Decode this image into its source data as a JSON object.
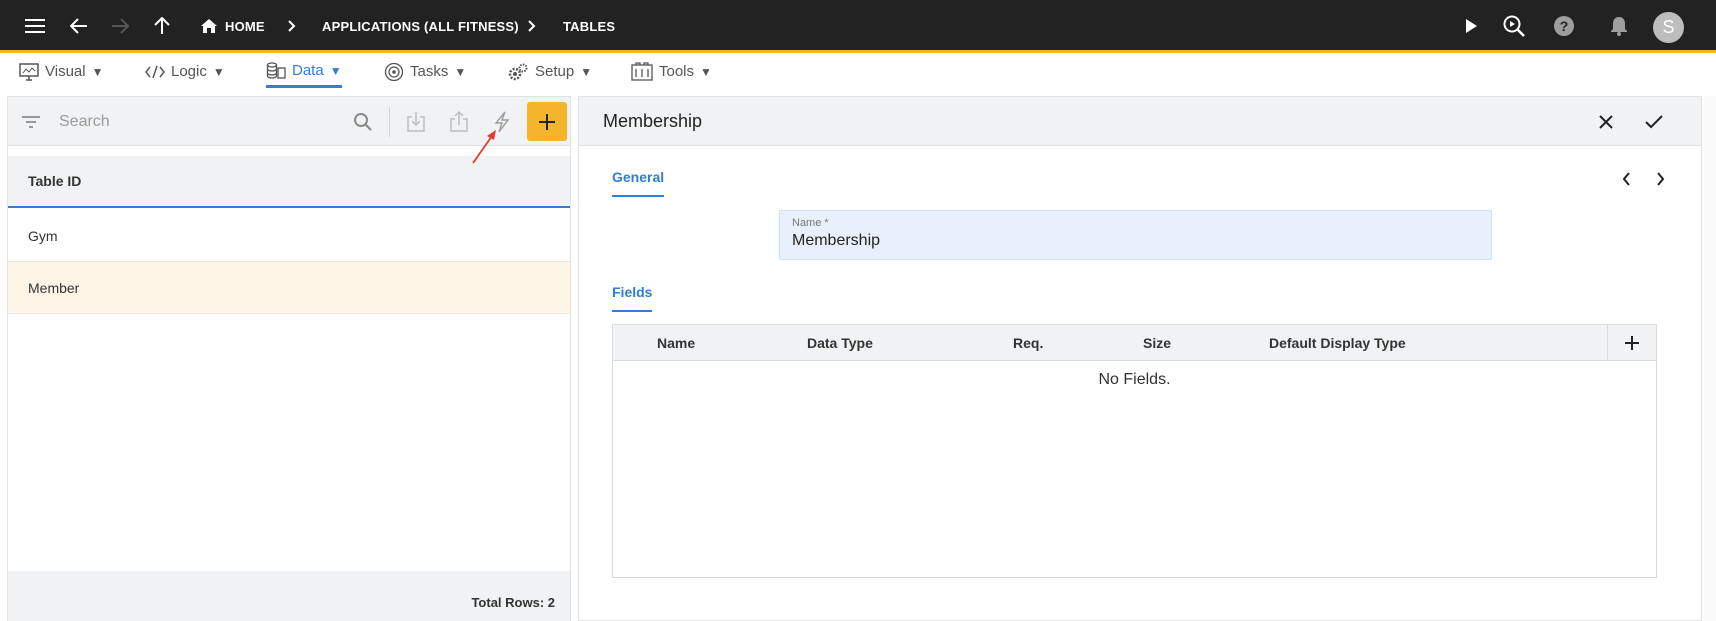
{
  "topbar": {
    "breadcrumbs": [
      "HOME",
      "APPLICATIONS (ALL FITNESS)",
      "TABLES"
    ],
    "avatar_initial": "S"
  },
  "menu": {
    "items": [
      {
        "label": "Visual",
        "icon": "monitor-icon"
      },
      {
        "label": "Logic",
        "icon": "code-icon"
      },
      {
        "label": "Data",
        "icon": "database-icon",
        "active": true
      },
      {
        "label": "Tasks",
        "icon": "tasks-icon"
      },
      {
        "label": "Setup",
        "icon": "gears-icon"
      },
      {
        "label": "Tools",
        "icon": "tools-icon"
      }
    ],
    "caret": "▼"
  },
  "left_panel": {
    "search_placeholder": "Search",
    "column_header": "Table ID",
    "rows": [
      "Gym",
      "Member"
    ],
    "selected_row": "Member",
    "footer": "Total Rows: 2"
  },
  "right_panel": {
    "title": "Membership",
    "tab_general": "General",
    "name_label": "Name *",
    "name_value": "Membership",
    "tab_fields": "Fields",
    "fields_columns": [
      "Name",
      "Data Type",
      "Req.",
      "Size",
      "Default Display Type"
    ],
    "empty_text": "No Fields."
  },
  "colors": {
    "accent": "#2f7fd6",
    "add_button": "#f6b42a",
    "topbar": "#222222",
    "topbar_border": "#f0b429",
    "selected_row": "#fff6e8",
    "annotation_arrow": "#e53935"
  }
}
